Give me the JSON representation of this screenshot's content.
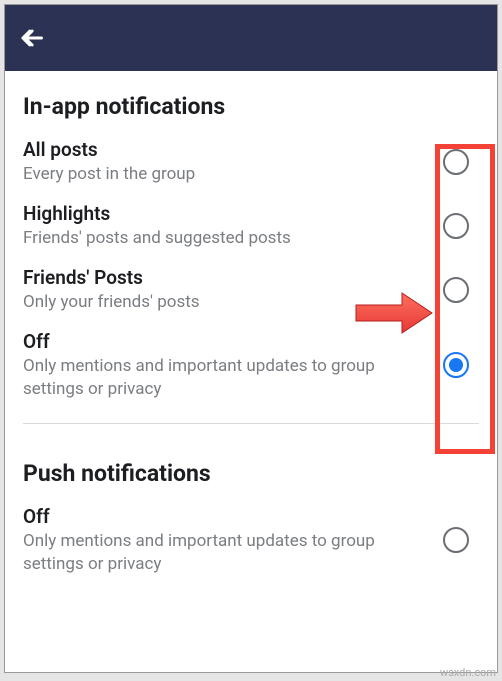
{
  "sections": {
    "in_app": {
      "title": "In-app notifications",
      "options": [
        {
          "title": "All posts",
          "sub": "Every post in the group",
          "selected": false
        },
        {
          "title": "Highlights",
          "sub": "Friends' posts and suggested posts",
          "selected": false
        },
        {
          "title": "Friends' Posts",
          "sub": "Only your friends' posts",
          "selected": false
        },
        {
          "title": "Off",
          "sub": "Only mentions and important updates to group settings or privacy",
          "selected": true
        }
      ]
    },
    "push": {
      "title": "Push notifications",
      "options": [
        {
          "title": "Off",
          "sub": "Only mentions and important updates to group settings or privacy",
          "selected": false
        }
      ]
    }
  },
  "watermark": "wsxdn.com",
  "colors": {
    "header_bg": "#2b3254",
    "accent": "#1877f2",
    "annotation": "#f44336"
  }
}
